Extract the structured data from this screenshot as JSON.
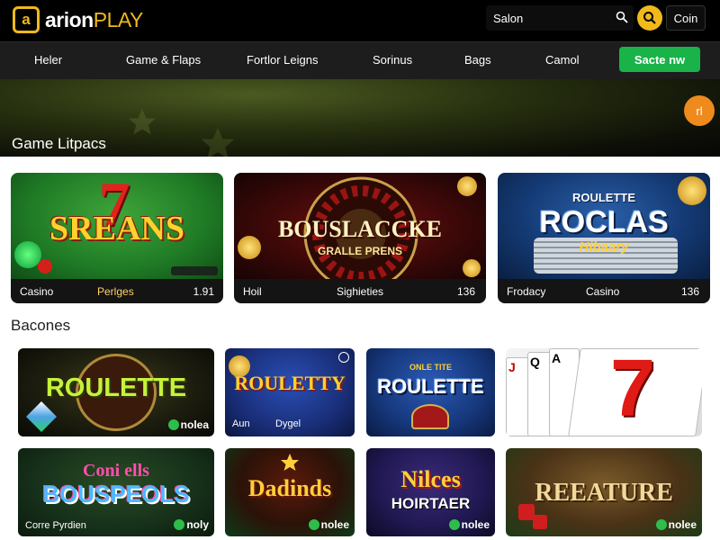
{
  "header": {
    "logo_mark": "a",
    "logo_brand": "arion",
    "logo_suffix": "PLAY",
    "search_placeholder": "Salon",
    "coin_label": "Coin"
  },
  "nav": {
    "items": [
      "Heler",
      "Game & Flaps",
      "Fortlor Leigns",
      "Sorinus",
      "Bags",
      "Camol"
    ],
    "cta_label": "Sacte nw"
  },
  "hero": {
    "title": "Game Litpacs",
    "fab_label": "rl"
  },
  "featured": [
    {
      "art_title": "SREANS",
      "art_number": "7",
      "left": "Casino",
      "mid": "Perlges",
      "right": "1.91"
    },
    {
      "art_title": "BOUSLACCKE",
      "art_sub": "GRALLE PRENS",
      "left": "Hoil",
      "mid": "Sighieties",
      "right": "136"
    },
    {
      "art_title": "ROCLAS",
      "art_top": "ROULETTE",
      "art_sub": "Hibaary",
      "left": "Frodacy",
      "mid": "Casino",
      "right": "136"
    }
  ],
  "section_title": "Bacones",
  "tiles": [
    {
      "title": "ROULETTE",
      "badge": "nolea"
    },
    {
      "title": "ROULETTY",
      "cap_left": "Aun",
      "cap_mid": "Dygel"
    },
    {
      "title": "ROULETTE",
      "top": "ONLE TITE"
    },
    {
      "cards": [
        "J",
        "Q",
        "A",
        "7"
      ]
    },
    {
      "line1": "Coni ells",
      "line2": "BOUSPEOLS",
      "cap": "Corre Pyrdien",
      "badge": "noly"
    },
    {
      "title": "Dadinds",
      "badge": "nolee"
    },
    {
      "line1": "Nilces",
      "line2": "HOIRTAER",
      "badge": "nolee"
    },
    {
      "title": "REEATURE",
      "badge": "nolee"
    }
  ],
  "colors": {
    "accent": "#f0b91c",
    "cta": "#19b34a",
    "fab": "#ef8a1d",
    "nav_bg": "#1d1d1d"
  }
}
